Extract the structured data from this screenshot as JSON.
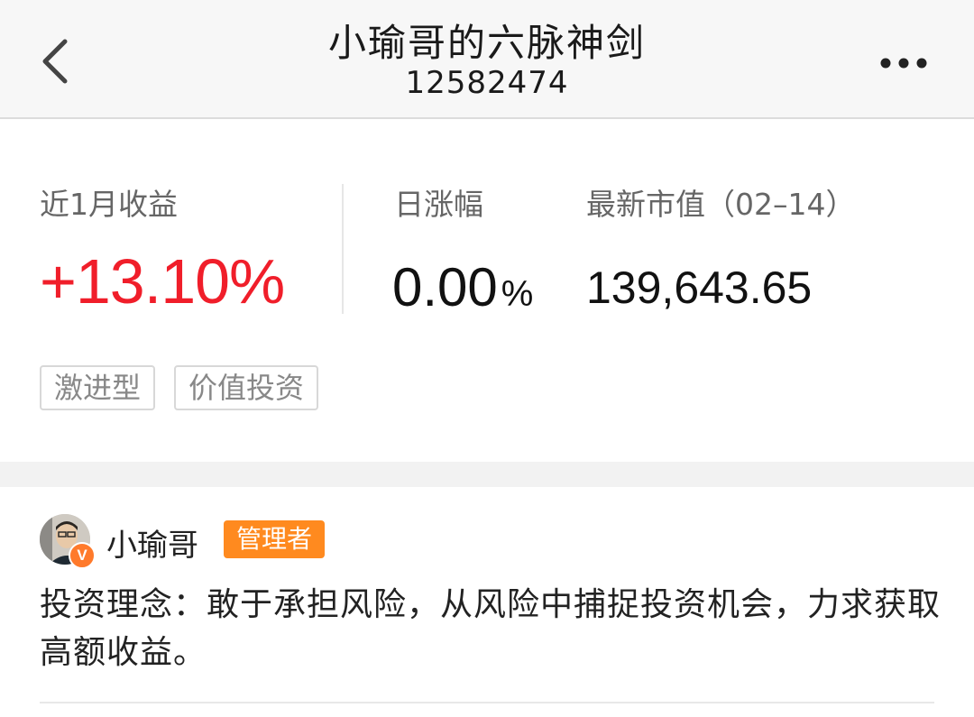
{
  "header": {
    "title": "小瑜哥的六脉神剑",
    "portfolio_id": "12582474",
    "back_icon": "chevron-left-icon",
    "more_icon": "more-horizontal-icon"
  },
  "stats": {
    "monthly_return_label": "近1月收益",
    "monthly_return_value": "+13.10%",
    "daily_change_label": "日涨幅",
    "daily_change_value": "0.00",
    "daily_change_unit": "%",
    "market_value_label": "最新市值（02–14）",
    "market_value": "139,643.65",
    "accent_color": "#f01e2a"
  },
  "tags": [
    "激进型",
    "价值投资"
  ],
  "manager": {
    "name": "小瑜哥",
    "role_badge": "管理者",
    "verified_mark": "V",
    "badge_color": "#ff8a1f",
    "philosophy": "投资理念：敢于承担风险，从风险中捕捉投资机会，力求获取高额收益。"
  }
}
